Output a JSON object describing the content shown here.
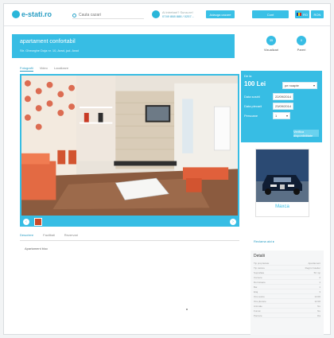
{
  "site": {
    "logo": "e-stati.ro",
    "search_placeholder": "Cauta cazari",
    "phone": {
      "line1": "Ai intrebari? Suna-ne!",
      "number": "0749 888 888 / 0257..."
    },
    "nav": {
      "b1": "Adauga cazare",
      "b2": "Cont",
      "b3": "RO",
      "b4": "RON"
    }
  },
  "listing": {
    "title": "apartament confortabil",
    "subtitle": "Str. Gheorghe Doja nr. 10, Arad, jud. Arad",
    "stats": [
      {
        "value": "35",
        "label": "Vizualizari"
      },
      {
        "value": "0",
        "label": "Pareri"
      }
    ],
    "top_tabs": [
      "Fotografii",
      "Video",
      "Localizare"
    ],
    "bottom_tabs": [
      "Descriere",
      "Facilitati",
      "Rezervari"
    ],
    "description": "Apartament bloc"
  },
  "booking": {
    "label_de_la": "De la",
    "price": "100 Lei",
    "per": "pe noapte",
    "data_sosirii_label": "Data sosirii",
    "data_sosirii": "22/09/2014",
    "data_plecarii_label": "Data plecarii",
    "data_plecarii": "23/09/2014",
    "persoane_label": "Persoane",
    "persoane": "1",
    "check_button": "Verifica disponibilitate"
  },
  "ad": {
    "caption": "Maxca",
    "link": "Reclama aici"
  },
  "details": {
    "title": "Detalii",
    "rows": [
      {
        "k": "Tip proprietate",
        "v": "Apartament"
      },
      {
        "k": "Tip cazare",
        "v": "Regim hotelier"
      },
      {
        "k": "Suprafata",
        "v": "50 mp"
      },
      {
        "k": "Camere",
        "v": "2"
      },
      {
        "k": "Dormitoare",
        "v": "1"
      },
      {
        "k": "Bai",
        "v": "1"
      },
      {
        "k": "Etaj",
        "v": "3"
      },
      {
        "k": "Ora sosire",
        "v": "14:00"
      },
      {
        "k": "Ora plecare",
        "v": "12:00"
      },
      {
        "k": "Animale",
        "v": "Nu"
      },
      {
        "k": "Fumat",
        "v": "Nu"
      },
      {
        "k": "Parcare",
        "v": "Da"
      }
    ]
  },
  "colors": {
    "accent": "#37bde4",
    "link": "#2a9ec4"
  }
}
